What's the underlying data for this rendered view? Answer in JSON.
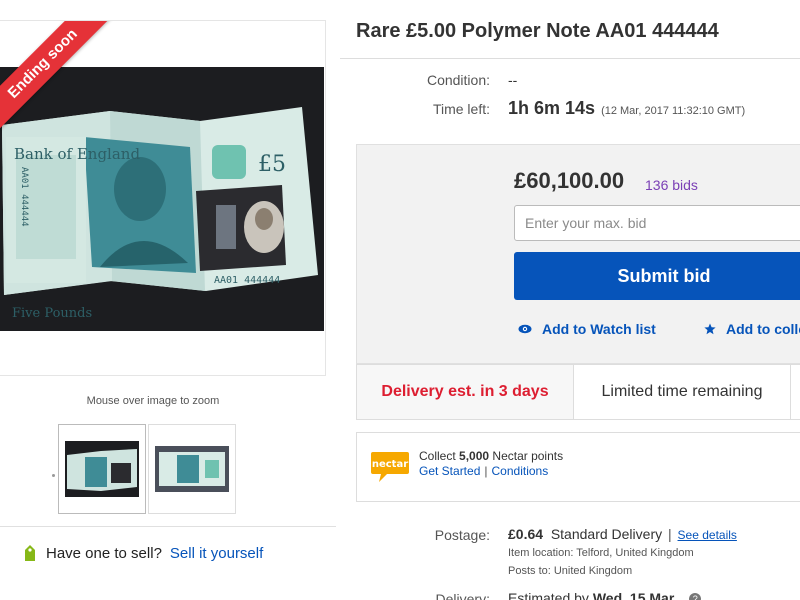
{
  "listing": {
    "badge": "Ending soon",
    "zoom_hint": "Mouse over image to zoom",
    "note": {
      "bank_text": "Bank of England",
      "denomination": "£5",
      "words": "Five Pounds",
      "serial": "AA01 444444"
    },
    "sell": {
      "question": "Have one to sell?",
      "link": "Sell it yourself"
    }
  },
  "item": {
    "title": "Rare £5.00 Polymer Note AA01 444444",
    "condition_label": "Condition:",
    "condition_value": "--",
    "time_label": "Time left:",
    "time_left": "1h 6m 14s",
    "end_time": "(12 Mar, 2017   11:32:10 GMT)"
  },
  "bidding": {
    "price": "£60,100.00",
    "bids": "136 bids",
    "max_bid_placeholder": "Enter your max. bid",
    "submit_label": "Submit bid",
    "watch_label": "Add to Watch list",
    "collection_label": "Add to colle"
  },
  "tabs": {
    "delivery": "Delivery est. in 3 days",
    "limited": "Limited time remaining"
  },
  "nectar": {
    "logo_text": "nectar",
    "collect_prefix": "Collect",
    "points": "5,000",
    "collect_suffix": "Nectar points",
    "get_started": "Get Started",
    "separator": "|",
    "conditions": "Conditions"
  },
  "shipping": {
    "postage_label": "Postage:",
    "postage_price": "£0.64",
    "postage_service": "Standard Delivery",
    "separator": "|",
    "see_details": "See details",
    "item_location": "Item location:  Telford, United Kingdom",
    "posts_to": "Posts to:  United Kingdom",
    "delivery_label": "Delivery:",
    "delivery_prefix": "Estimated by",
    "delivery_date": "Wed. 15 Mar."
  },
  "colors": {
    "accent_blue": "#0654ba",
    "badge_red": "#e53238",
    "delivery_red": "#dd1e31",
    "bids_purple": "#7a3fb5",
    "note_teal": "#4f9aa3"
  },
  "icons": [
    "ending-soon-ribbon",
    "eye-icon",
    "star-icon",
    "tag-icon",
    "nectar-logo",
    "help-icon"
  ]
}
